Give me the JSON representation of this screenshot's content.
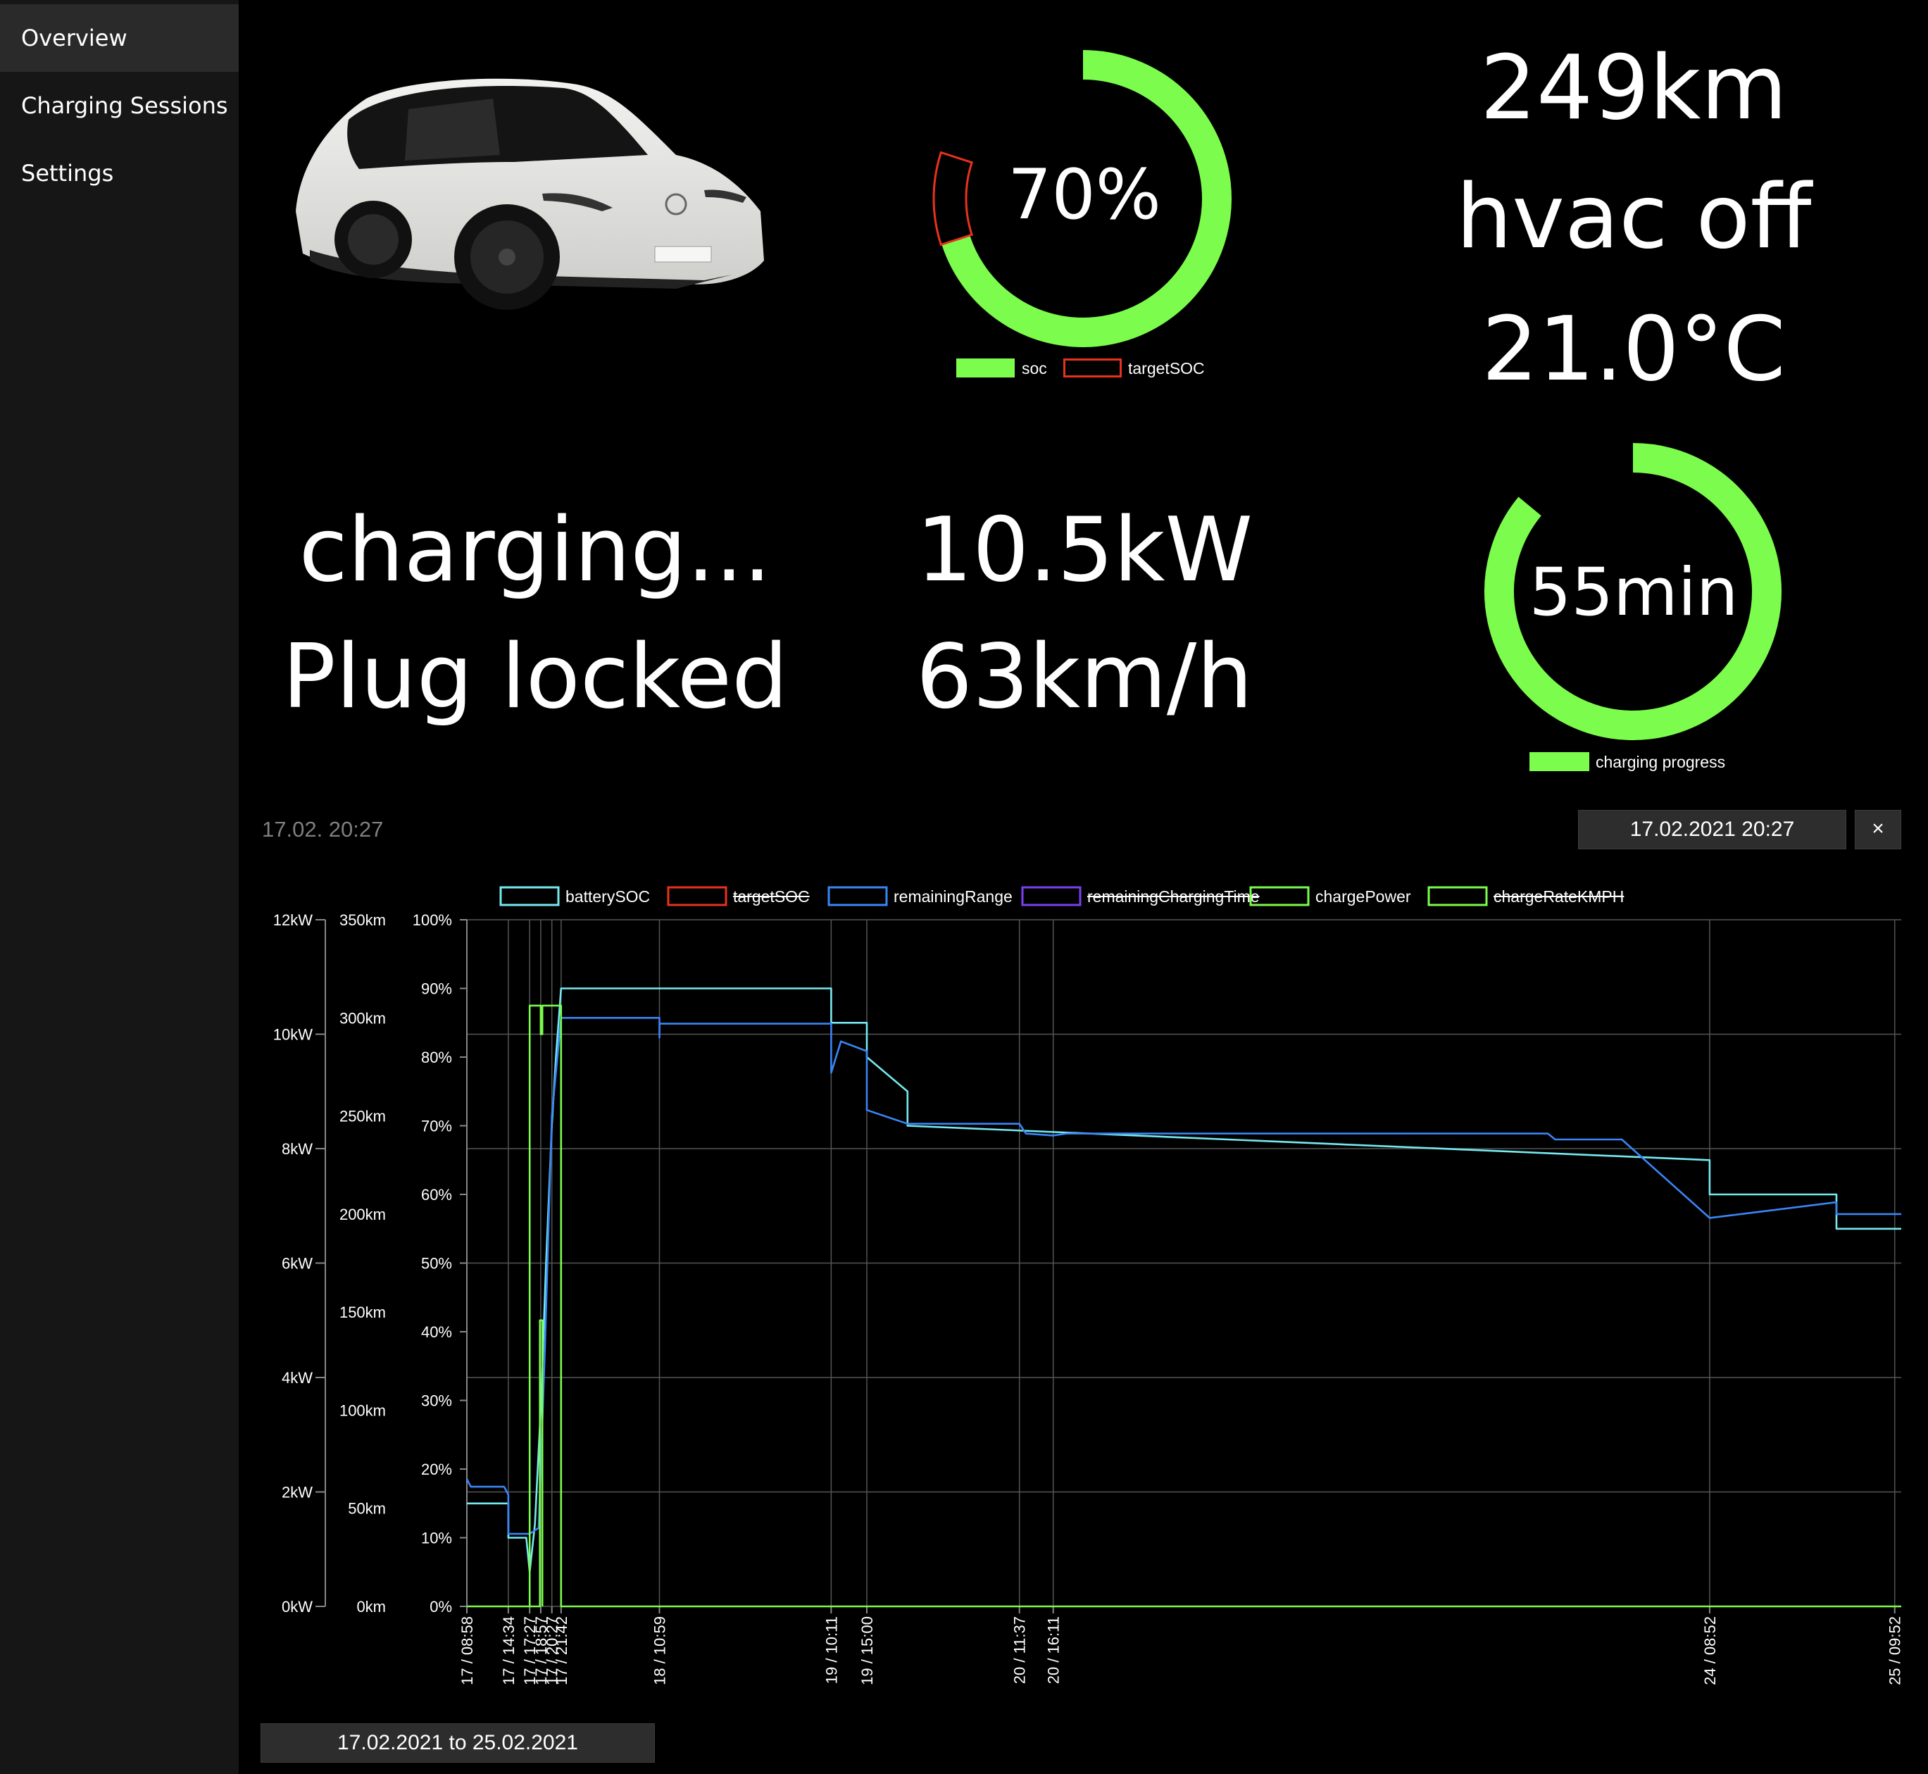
{
  "sidebar": {
    "items": [
      {
        "label": "Overview",
        "active": true
      },
      {
        "label": "Charging Sessions",
        "active": false
      },
      {
        "label": "Settings",
        "active": false
      }
    ]
  },
  "soc_gauge": {
    "value_text": "70%",
    "soc": 70,
    "target_soc": 80,
    "colors": {
      "soc": "#7cfc4c",
      "target": "#e8321e"
    },
    "legend": [
      "soc",
      "targetSOC"
    ]
  },
  "status": {
    "range": "249km",
    "hvac": "hvac off",
    "temperature": "21.0°C",
    "charging_state": "charging...",
    "plug_state": "Plug locked",
    "charge_power": "10.5kW",
    "charge_rate": "63km/h"
  },
  "progress_gauge": {
    "value_text": "55min",
    "progress": 0.86,
    "color": "#7cfc4c",
    "legend": "charging progress"
  },
  "history": {
    "timestamp_label": "17.02. 20:27",
    "selected_datetime": "17.02.2021 20:27",
    "clear_label": "×",
    "range_label": "17.02.2021 to 25.02.2021"
  },
  "chart_data": {
    "type": "line",
    "legend": [
      {
        "name": "batterySOC",
        "color": "#75eaf0",
        "hidden": false
      },
      {
        "name": "targetSOC",
        "color": "#e8321e",
        "hidden": true
      },
      {
        "name": "remainingRange",
        "color": "#3a86f5",
        "hidden": false
      },
      {
        "name": "remainingChargingTime",
        "color": "#7c3ff0",
        "hidden": true
      },
      {
        "name": "chargePower",
        "color": "#7cfc4c",
        "hidden": false
      },
      {
        "name": "chargeRateKMPH",
        "color": "#7cfc4c",
        "hidden": true
      }
    ],
    "axes": {
      "power": {
        "ticks": [
          "0kW",
          "2kW",
          "4kW",
          "6kW",
          "8kW",
          "10kW",
          "12kW"
        ],
        "ylim": [
          0,
          12
        ]
      },
      "range": {
        "ticks": [
          "0km",
          "50km",
          "100km",
          "150km",
          "200km",
          "250km",
          "300km",
          "350km"
        ],
        "ylim": [
          0,
          350
        ]
      },
      "soc": {
        "ticks": [
          "0%",
          "10%",
          "20%",
          "30%",
          "40%",
          "50%",
          "60%",
          "70%",
          "80%",
          "90%",
          "100%"
        ],
        "ylim": [
          0,
          100
        ]
      }
    },
    "xlim": [
      "17/02 08:58",
      "25/02 10:45"
    ],
    "x_ticks": [
      {
        "label": "17 / 08:58",
        "t": "17/02 08:58"
      },
      {
        "label": "17 / 14:34",
        "t": "17/02 14:34"
      },
      {
        "label": "17 / 17:27",
        "t": "17/02 17:27"
      },
      {
        "label": "17 / 18:57",
        "t": "17/02 18:57"
      },
      {
        "label": "17 / 20:27",
        "t": "17/02 20:27"
      },
      {
        "label": "17 / 21:42",
        "t": "17/02 21:42"
      },
      {
        "label": "18 / 10:59",
        "t": "18/02 10:59"
      },
      {
        "label": "19 / 10:11",
        "t": "19/02 10:11"
      },
      {
        "label": "19 / 15:00",
        "t": "19/02 15:00"
      },
      {
        "label": "20 / 11:37",
        "t": "20/02 11:37"
      },
      {
        "label": "20 / 16:11",
        "t": "20/02 16:11"
      },
      {
        "label": "24 / 08:52",
        "t": "24/02 08:52"
      },
      {
        "label": "25 / 09:52",
        "t": "25/02 09:52"
      }
    ],
    "series": [
      {
        "name": "batterySOC",
        "axis": "soc",
        "points": [
          [
            "17/02 08:58",
            15
          ],
          [
            "17/02 14:34",
            15
          ],
          [
            "17/02 14:34",
            10
          ],
          [
            "17/02 17:00",
            10
          ],
          [
            "17/02 17:27",
            5
          ],
          [
            "17/02 18:10",
            12
          ],
          [
            "17/02 19:00",
            30
          ],
          [
            "17/02 19:40",
            50
          ],
          [
            "17/02 20:27",
            70
          ],
          [
            "17/02 21:00",
            80
          ],
          [
            "17/02 21:42",
            90
          ],
          [
            "19/02 10:11",
            90
          ],
          [
            "19/02 10:11",
            85
          ],
          [
            "19/02 15:00",
            85
          ],
          [
            "19/02 15:00",
            80
          ],
          [
            "19/02 20:30",
            75
          ],
          [
            "19/02 20:30",
            70
          ],
          [
            "24/02 08:52",
            65
          ],
          [
            "24/02 08:52",
            60
          ],
          [
            "25/02 02:00",
            60
          ],
          [
            "25/02 02:00",
            55
          ],
          [
            "25/02 10:45",
            55
          ]
        ]
      },
      {
        "name": "remainingRange",
        "axis": "range",
        "points": [
          [
            "17/02 08:58",
            65
          ],
          [
            "17/02 09:30",
            61
          ],
          [
            "17/02 14:00",
            61
          ],
          [
            "17/02 14:34",
            57
          ],
          [
            "17/02 14:34",
            37
          ],
          [
            "17/02 17:27",
            37
          ],
          [
            "17/02 18:40",
            40
          ],
          [
            "17/02 19:30",
            130
          ],
          [
            "17/02 20:27",
            250
          ],
          [
            "17/02 21:42",
            300
          ],
          [
            "18/02 10:59",
            300
          ],
          [
            "18/02 10:59",
            290
          ],
          [
            "18/02 11:00",
            297
          ],
          [
            "19/02 10:11",
            297
          ],
          [
            "19/02 10:11",
            272
          ],
          [
            "19/02 11:30",
            288
          ],
          [
            "19/02 15:00",
            283
          ],
          [
            "19/02 15:00",
            253
          ],
          [
            "19/02 20:30",
            246
          ],
          [
            "20/02 11:37",
            246
          ],
          [
            "20/02 12:30",
            241
          ],
          [
            "20/02 16:11",
            240
          ],
          [
            "20/02 18:00",
            241
          ],
          [
            "23/02 11:00",
            241
          ],
          [
            "23/02 12:00",
            238
          ],
          [
            "23/02 21:00",
            238
          ],
          [
            "24/02 08:52",
            198
          ],
          [
            "25/02 02:00",
            206
          ],
          [
            "25/02 02:00",
            200
          ],
          [
            "25/02 10:45",
            200
          ]
        ]
      },
      {
        "name": "chargePower",
        "axis": "power",
        "points": [
          [
            "17/02 08:58",
            0
          ],
          [
            "17/02 17:27",
            0
          ],
          [
            "17/02 17:27",
            10.5
          ],
          [
            "17/02 18:57",
            10.5
          ],
          [
            "17/02 18:57",
            10.0
          ],
          [
            "17/02 19:10",
            10.0
          ],
          [
            "17/02 19:10",
            10.5
          ],
          [
            "17/02 21:42",
            10.5
          ],
          [
            "17/02 21:42",
            0
          ],
          [
            "25/02 10:45",
            0
          ]
        ]
      },
      {
        "name": "chargePower-pulse",
        "axis": "power",
        "points": [
          [
            "17/02 17:30",
            0
          ],
          [
            "17/02 18:50",
            0
          ],
          [
            "17/02 18:50",
            5
          ],
          [
            "17/02 19:10",
            5
          ],
          [
            "17/02 19:10",
            0
          ]
        ]
      }
    ]
  }
}
